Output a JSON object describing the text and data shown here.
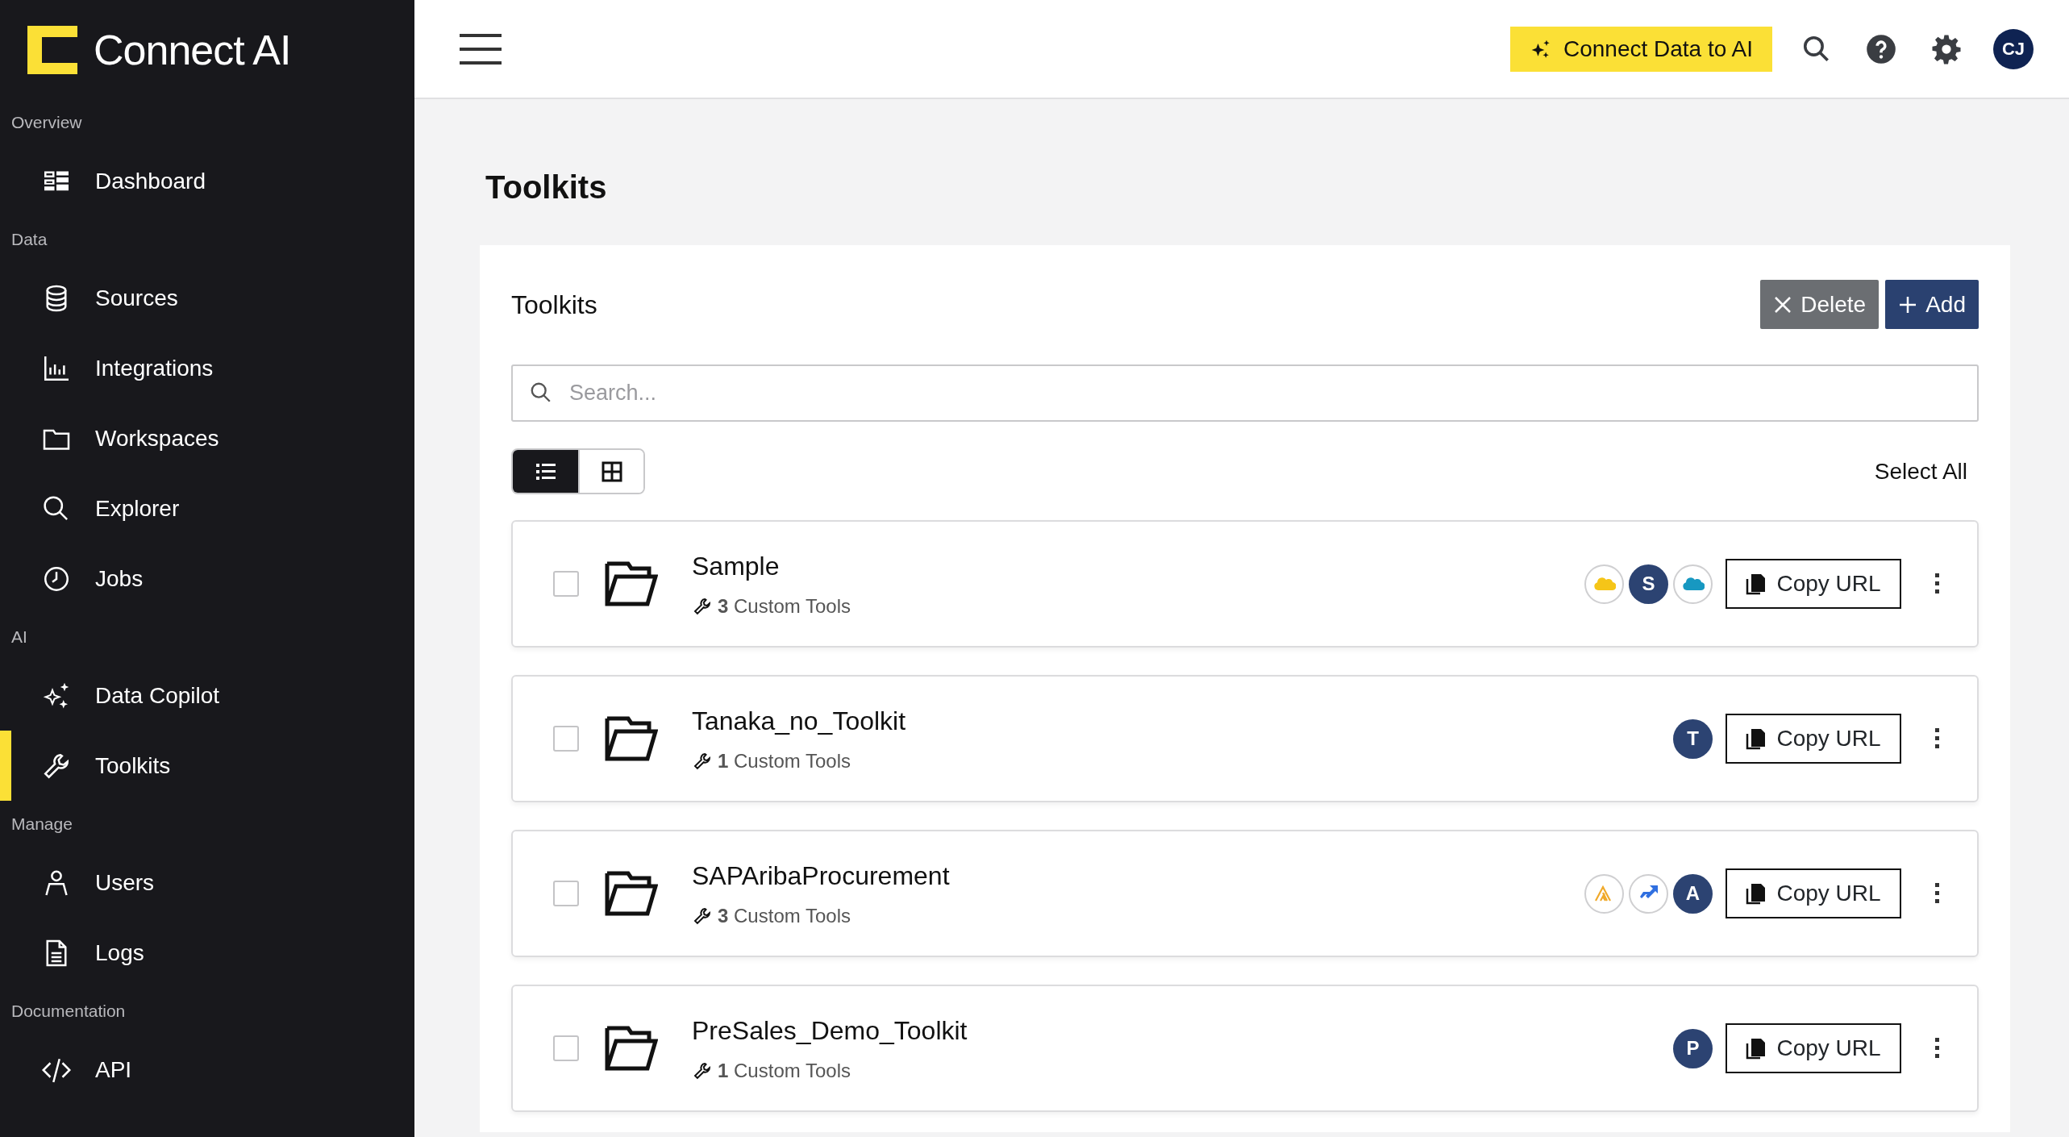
{
  "brand": {
    "name": "Connect AI"
  },
  "sidebar": {
    "sections": [
      {
        "label": "Overview",
        "items": [
          {
            "label": "Dashboard",
            "selected": false
          }
        ]
      },
      {
        "label": "Data",
        "items": [
          {
            "label": "Sources",
            "selected": false
          },
          {
            "label": "Integrations",
            "selected": false
          },
          {
            "label": "Workspaces",
            "selected": false
          },
          {
            "label": "Explorer",
            "selected": false
          },
          {
            "label": "Jobs",
            "selected": false
          }
        ]
      },
      {
        "label": "AI",
        "items": [
          {
            "label": "Data Copilot",
            "selected": false
          },
          {
            "label": "Toolkits",
            "selected": true
          }
        ]
      },
      {
        "label": "Manage",
        "items": [
          {
            "label": "Users",
            "selected": false
          },
          {
            "label": "Logs",
            "selected": false
          }
        ]
      },
      {
        "label": "Documentation",
        "items": [
          {
            "label": "API",
            "selected": false
          }
        ]
      }
    ]
  },
  "topbar": {
    "cta": "Connect Data to AI",
    "avatar": "CJ"
  },
  "page": {
    "title": "Toolkits"
  },
  "panel": {
    "title": "Toolkits",
    "buttons": [
      {
        "label": "Delete",
        "kind": "delete"
      },
      {
        "label": "Add",
        "kind": "add"
      }
    ],
    "search": {
      "placeholder": "Search..."
    },
    "views": [
      {
        "kind": "list",
        "selected": true
      },
      {
        "kind": "grid",
        "selected": false
      }
    ],
    "select_all": "Select All",
    "rows": [
      {
        "name": "Sample",
        "tools": "**3** Custom Tools",
        "checked": false,
        "sources": [
          {
            "kind": "cloud",
            "color": "#f5c518"
          },
          {
            "kind": "letter",
            "letter": "S"
          },
          {
            "kind": "cloud",
            "color": "#1798c1"
          }
        ],
        "action": "Copy URL"
      },
      {
        "name": "Tanaka_no_Toolkit",
        "tools": "**1** Custom Tools",
        "checked": false,
        "sources": [
          {
            "kind": "letter",
            "letter": "T"
          }
        ],
        "action": "Copy URL"
      },
      {
        "name": "SAPAribaProcurement",
        "tools": "**3** Custom Tools",
        "checked": false,
        "sources": [
          {
            "kind": "chevrons"
          },
          {
            "kind": "arrows"
          },
          {
            "kind": "letter",
            "letter": "A"
          }
        ],
        "action": "Copy URL"
      },
      {
        "name": "PreSales_Demo_Toolkit",
        "tools": "**1** Custom Tools",
        "checked": false,
        "sources": [
          {
            "kind": "letter",
            "letter": "P"
          }
        ],
        "action": "Copy URL"
      }
    ]
  }
}
